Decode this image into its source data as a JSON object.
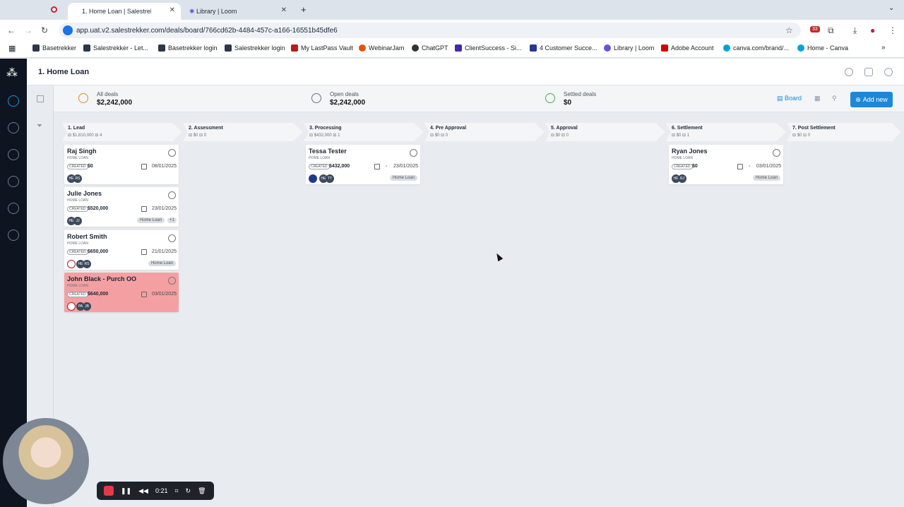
{
  "browser": {
    "tabs": [
      {
        "label": "1. Home Loan | Salestrekk",
        "active": true
      },
      {
        "label": "Library | Loom",
        "active": false
      }
    ],
    "new_tab": "+",
    "url": "app.uat.v2.salestrekker.com/deals/board/766cd62b-4484-457c-a166-16551b45dfe6",
    "extensions_badge": "33",
    "bookmarks": [
      "Basetrekker",
      "Salestrekker - Let...",
      "Basetrekker login",
      "Salestrekker login",
      "My LastPass Vault",
      "WebinarJam",
      "ChatGPT",
      "ClientSuccess - Si...",
      "4 Customer Succe...",
      "Library | Loom",
      "Adobe Account",
      "canva.com/brand/...",
      "Home - Canva"
    ]
  },
  "header": {
    "title": "1. Home Loan"
  },
  "stats": [
    {
      "label": "All deals",
      "value": "$2,242,000",
      "color": "#e08a2c"
    },
    {
      "label": "Open deals",
      "value": "$2,242,000",
      "color": "#6b7280"
    },
    {
      "label": "Settled deals",
      "value": "$0",
      "color": "#54a84a"
    }
  ],
  "toolbar": {
    "board_label": "Board",
    "add_new_label": "Add new"
  },
  "columns": [
    {
      "name": "1. Lead",
      "amount": "$1,810,000",
      "count": "4"
    },
    {
      "name": "2. Assessment",
      "amount": "$0",
      "count": "0"
    },
    {
      "name": "3. Processing",
      "amount": "$432,000",
      "count": "1"
    },
    {
      "name": "4. Pre Approval",
      "amount": "$0",
      "count": "0"
    },
    {
      "name": "5. Approval",
      "amount": "$0",
      "count": "0"
    },
    {
      "name": "6. Settlement",
      "amount": "$0",
      "count": "1"
    },
    {
      "name": "7. Post Settlement",
      "amount": "$0",
      "count": "0"
    }
  ],
  "cards": [
    {
      "name": "Raj Singh",
      "type": "HOME LOAN",
      "status": "CREATED",
      "amount": "$0",
      "date": "08/01/2025",
      "avatars": [
        "HE",
        "RS"
      ],
      "tag": ""
    },
    {
      "name": "Julie Jones",
      "type": "HOME LOAN",
      "status": "CREATED",
      "amount": "$520,000",
      "date": "23/01/2025",
      "avatars": [
        "HE",
        "JJ"
      ],
      "tag": "Home Loan",
      "extra": "+1"
    },
    {
      "name": "Robert Smith",
      "type": "HOME LOAN",
      "status": "CREATED",
      "amount": "$650,000",
      "date": "21/01/2025",
      "avatars": [
        "",
        "HE",
        "RS"
      ],
      "tag": "Home Loan"
    },
    {
      "name": "John Black - Purch OO",
      "type": "HOME LOAN",
      "status": "CREATED",
      "amount": "$640,000",
      "date": "03/01/2025",
      "avatars": [
        "",
        "PA",
        "JB"
      ],
      "tag": ""
    },
    {
      "name": "Tessa Tester",
      "type": "HOME LOAN",
      "status": "CREATED",
      "amount": "$432,000",
      "date": "23/01/2025",
      "avatars": [
        "",
        "HE",
        "TT"
      ],
      "tag": "Home Loan"
    },
    {
      "name": "Ryan Jones",
      "type": "HOME LOAN",
      "status": "CREATED",
      "amount": "$0",
      "date": "03/01/2025",
      "avatars": [
        "HE",
        "RJ"
      ],
      "tag": "Home Loan"
    }
  ],
  "recorder": {
    "time": "0:21"
  }
}
